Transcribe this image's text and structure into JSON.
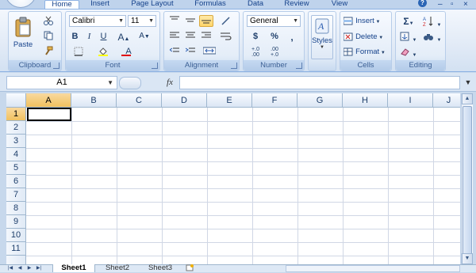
{
  "tabs": [
    "Home",
    "Insert",
    "Page Layout",
    "Formulas",
    "Data",
    "Review",
    "View"
  ],
  "active_tab": "Home",
  "help_label": "?",
  "window_controls": [
    "–",
    "▫",
    "×"
  ],
  "clipboard": {
    "label": "Clipboard",
    "paste": "Paste"
  },
  "font": {
    "label": "Font",
    "name": "Calibri",
    "size": "11",
    "bold": "B",
    "italic": "I",
    "underline": "U",
    "grow": "A",
    "shrink": "A",
    "fill_icon": "fill-color-icon",
    "font_color": "A"
  },
  "alignment": {
    "label": "Alignment"
  },
  "number": {
    "label": "Number",
    "format": "General",
    "currency": "$",
    "percent": "%",
    "comma": ",",
    "inc_dec": "+.0\n.00",
    "dec_dec": ".00\n+.0"
  },
  "styles": {
    "label": "Styles"
  },
  "cells": {
    "label": "Cells",
    "insert": "Insert",
    "delete": "Delete",
    "format": "Format"
  },
  "editing": {
    "label": "Editing",
    "sum": "Σ",
    "sort": "A Z"
  },
  "formula_bar": {
    "name_box": "A1",
    "fx": "fx",
    "formula": ""
  },
  "columns": [
    "A",
    "B",
    "C",
    "D",
    "E",
    "F",
    "G",
    "H",
    "I",
    "J"
  ],
  "rows": [
    "1",
    "2",
    "3",
    "4",
    "5",
    "6",
    "7",
    "8",
    "9",
    "10",
    "11"
  ],
  "active_cell": "A1",
  "sheets": [
    "Sheet1",
    "Sheet2",
    "Sheet3"
  ],
  "active_sheet": "Sheet1"
}
